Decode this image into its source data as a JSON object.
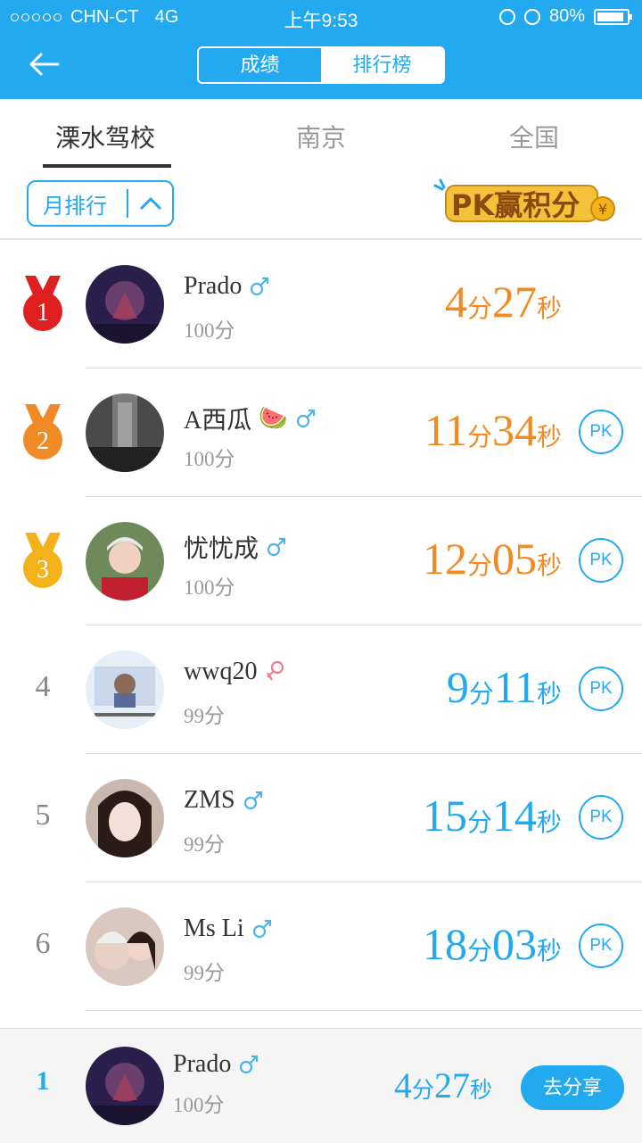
{
  "status": {
    "carrier": "CHN-CT",
    "network": "4G",
    "time": "上午9:53",
    "battery": "80%"
  },
  "header": {
    "segments": [
      {
        "label": "成绩",
        "active": false
      },
      {
        "label": "排行榜",
        "active": true
      }
    ]
  },
  "tabs": [
    {
      "label": "溧水驾校",
      "active": true
    },
    {
      "label": "南京",
      "active": false
    },
    {
      "label": "全国",
      "active": false
    }
  ],
  "filter": {
    "label": "月排行"
  },
  "banner": {
    "text": "PK赢积分"
  },
  "time_units": {
    "min": "分",
    "sec": "秒"
  },
  "pk_label": "PK",
  "colors": {
    "accent": "#22a9ef",
    "orange": "#f08a24",
    "gold": "#f3b21a",
    "red": "#e02020",
    "male": "#4ab4ea",
    "female": "#f07a8a"
  },
  "rows": [
    {
      "rank": "1",
      "medal": "gold-first",
      "name": "Prado",
      "gender": "male",
      "score": "100分",
      "minutes": "4",
      "seconds": "27",
      "pk": false
    },
    {
      "rank": "2",
      "medal": "second",
      "name": "A西瓜",
      "emoji": "🍉",
      "gender": "male",
      "score": "100分",
      "minutes": "11",
      "seconds": "34",
      "pk": true
    },
    {
      "rank": "3",
      "medal": "third",
      "name": "忧忧成",
      "gender": "male",
      "score": "100分",
      "minutes": "12",
      "seconds": "05",
      "pk": true
    },
    {
      "rank": "4",
      "name": "wwq20",
      "gender": "female",
      "score": "99分",
      "minutes": "9",
      "seconds": "11",
      "pk": true
    },
    {
      "rank": "5",
      "name": "ZMS",
      "gender": "male",
      "score": "99分",
      "minutes": "15",
      "seconds": "14",
      "pk": true
    },
    {
      "rank": "6",
      "name": "Ms Li",
      "gender": "male",
      "score": "99分",
      "minutes": "18",
      "seconds": "03",
      "pk": true
    }
  ],
  "me": {
    "rank": "1",
    "name": "Prado",
    "gender": "male",
    "score": "100分",
    "minutes": "4",
    "seconds": "27",
    "share_label": "去分享"
  }
}
